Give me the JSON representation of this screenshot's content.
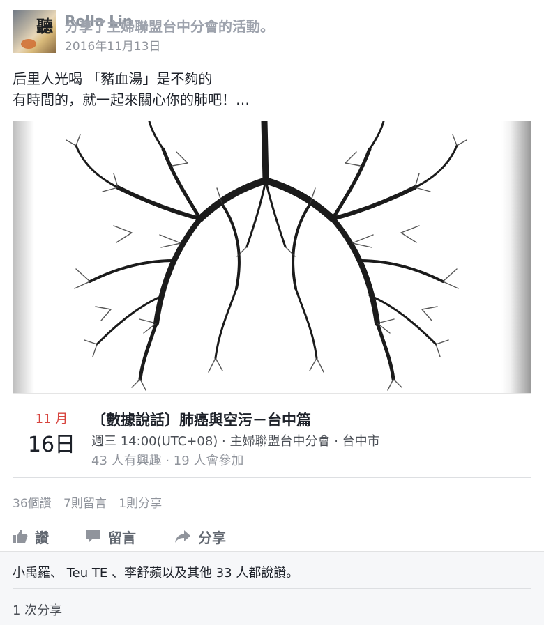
{
  "post": {
    "author": "Rolla Lin",
    "action": "分享了主婦聯盟台中分會的活動。",
    "date": "2016年11月13日",
    "avatar_glyph": "聽",
    "text_line1": "后里人光喝 「豬血湯」是不夠的",
    "text_line2": "有時間的，就一起來關心你的肺吧！…"
  },
  "event": {
    "month": "11 月",
    "day": "16日",
    "title": "〔數據說話〕肺癌與空污－台中篇",
    "when": "週三 14:00(UTC+08) · 主婦聯盟台中分會 · 台中市",
    "stats": "43 人有興趣 · 19 人會參加",
    "image_icon": "lung-tree-illustration"
  },
  "counts": {
    "likes": "36個讚",
    "comments": "7則留言",
    "shares": "1則分享"
  },
  "actions": {
    "like": "讚",
    "comment": "留言",
    "share": "分享",
    "like_icon": "thumbs-up-icon",
    "comment_icon": "speech-bubble-icon",
    "share_icon": "share-arrow-icon"
  },
  "footer": {
    "likes_summary": "小禹羅、 Teu TE 、李舒蘋以及其他 33 人都說讚。",
    "shares_summary": "1 次分享"
  },
  "colors": {
    "date_red": "#d7443e",
    "muted": "#90949c",
    "bottom_bg": "#f6f7f9"
  }
}
